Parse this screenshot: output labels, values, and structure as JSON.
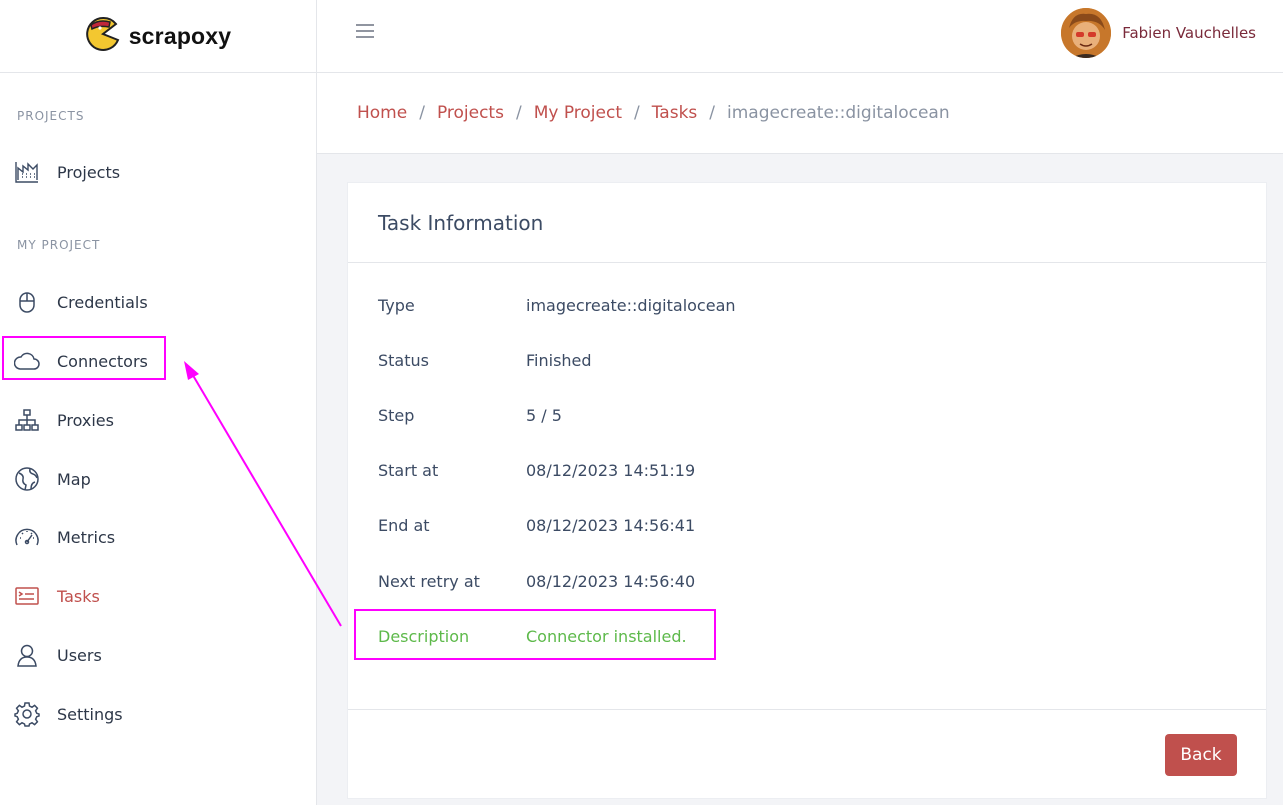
{
  "brand": {
    "name": "scrapoxy"
  },
  "header": {
    "user_name": "Fabien Vauchelles"
  },
  "sidebar": {
    "sections": [
      "PROJECTS",
      "MY PROJECT"
    ],
    "items": [
      {
        "label": "Projects",
        "icon": "chart-icon"
      },
      {
        "label": "Credentials",
        "icon": "lock-icon"
      },
      {
        "label": "Connectors",
        "icon": "cloud-icon"
      },
      {
        "label": "Proxies",
        "icon": "sitemap-icon"
      },
      {
        "label": "Map",
        "icon": "globe-icon"
      },
      {
        "label": "Metrics",
        "icon": "speedometer-icon"
      },
      {
        "label": "Tasks",
        "icon": "task-icon"
      },
      {
        "label": "Users",
        "icon": "user-icon"
      },
      {
        "label": "Settings",
        "icon": "gear-icon"
      }
    ]
  },
  "breadcrumb": {
    "items": [
      "Home",
      "Projects",
      "My Project",
      "Tasks"
    ],
    "current": "imagecreate::digitalocean",
    "separator": "/"
  },
  "task": {
    "title": "Task Information",
    "fields": [
      {
        "label": "Type",
        "value": "imagecreate::digitalocean"
      },
      {
        "label": "Status",
        "value": "Finished"
      },
      {
        "label": "Step",
        "value": "5 / 5"
      },
      {
        "label": "Start at",
        "value": "08/12/2023 14:51:19"
      },
      {
        "label": "End at",
        "value": "08/12/2023 14:56:41"
      },
      {
        "label": "Next retry at",
        "value": "08/12/2023 14:56:40"
      },
      {
        "label": "Description",
        "value": "Connector installed."
      }
    ],
    "back_label": "Back"
  },
  "colors": {
    "accent": "#c0504d",
    "success": "#5db94a",
    "annotation": "#ff00ff"
  }
}
